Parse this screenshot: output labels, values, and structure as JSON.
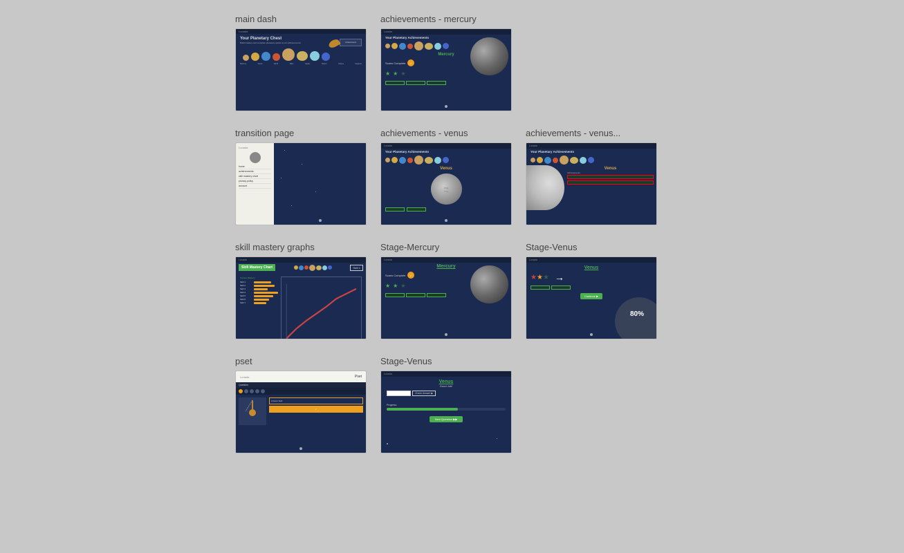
{
  "cards": [
    {
      "id": "main-dash",
      "label": "main dash",
      "type": "main-dash"
    },
    {
      "id": "achievements-mercury",
      "label": "achievements - mercury",
      "type": "ach-mercury"
    },
    {
      "id": "transition-page",
      "label": "transition page",
      "type": "transition"
    },
    {
      "id": "achievements-venus",
      "label": "achievements - venus",
      "type": "ach-venus"
    },
    {
      "id": "achievements-venus2",
      "label": "achievements - venus...",
      "type": "ach-venus2"
    },
    {
      "id": "skill-mastery-graphs",
      "label": "skill mastery graphs",
      "type": "skill-mastery"
    },
    {
      "id": "stage-mercury",
      "label": "Stage-Mercury",
      "type": "stage-mercury"
    },
    {
      "id": "stage-venus",
      "label": "Stage-Venus",
      "type": "stage-venus"
    },
    {
      "id": "pset",
      "label": "pset",
      "type": "pset"
    },
    {
      "id": "stage-venus-2",
      "label": "Stage-Venus",
      "type": "stage-venus-2"
    }
  ],
  "colors": {
    "accent_green": "#4caf50",
    "accent_orange": "#f0a020",
    "dark_blue": "#1a2a50",
    "darker_blue": "#15203a"
  },
  "labels": {
    "mercury": "Mercury",
    "venus": "Venus",
    "your_planetary_achievements": "Your Planetary Achievements",
    "your_planetary_chest": "Your Planetary Chest",
    "scan_complete": "Scans Complete",
    "skill_mastery_chart": "Skill Mastery Chart",
    "skill_mastery": "Skill Mastery",
    "stage_mercury": "Stage-Mercury",
    "stage_venus": "Stage-Venus",
    "pset": "pset",
    "transition_page": "transition page",
    "eighty_percent": "80%",
    "good_job": "Good Job!",
    "progress": "Progress:",
    "continue": "Continue ▶",
    "next_question": "Next Question ▶▶",
    "achievements_venus": "achievements - venus",
    "achievements_mercury": "achievements - mercury"
  }
}
